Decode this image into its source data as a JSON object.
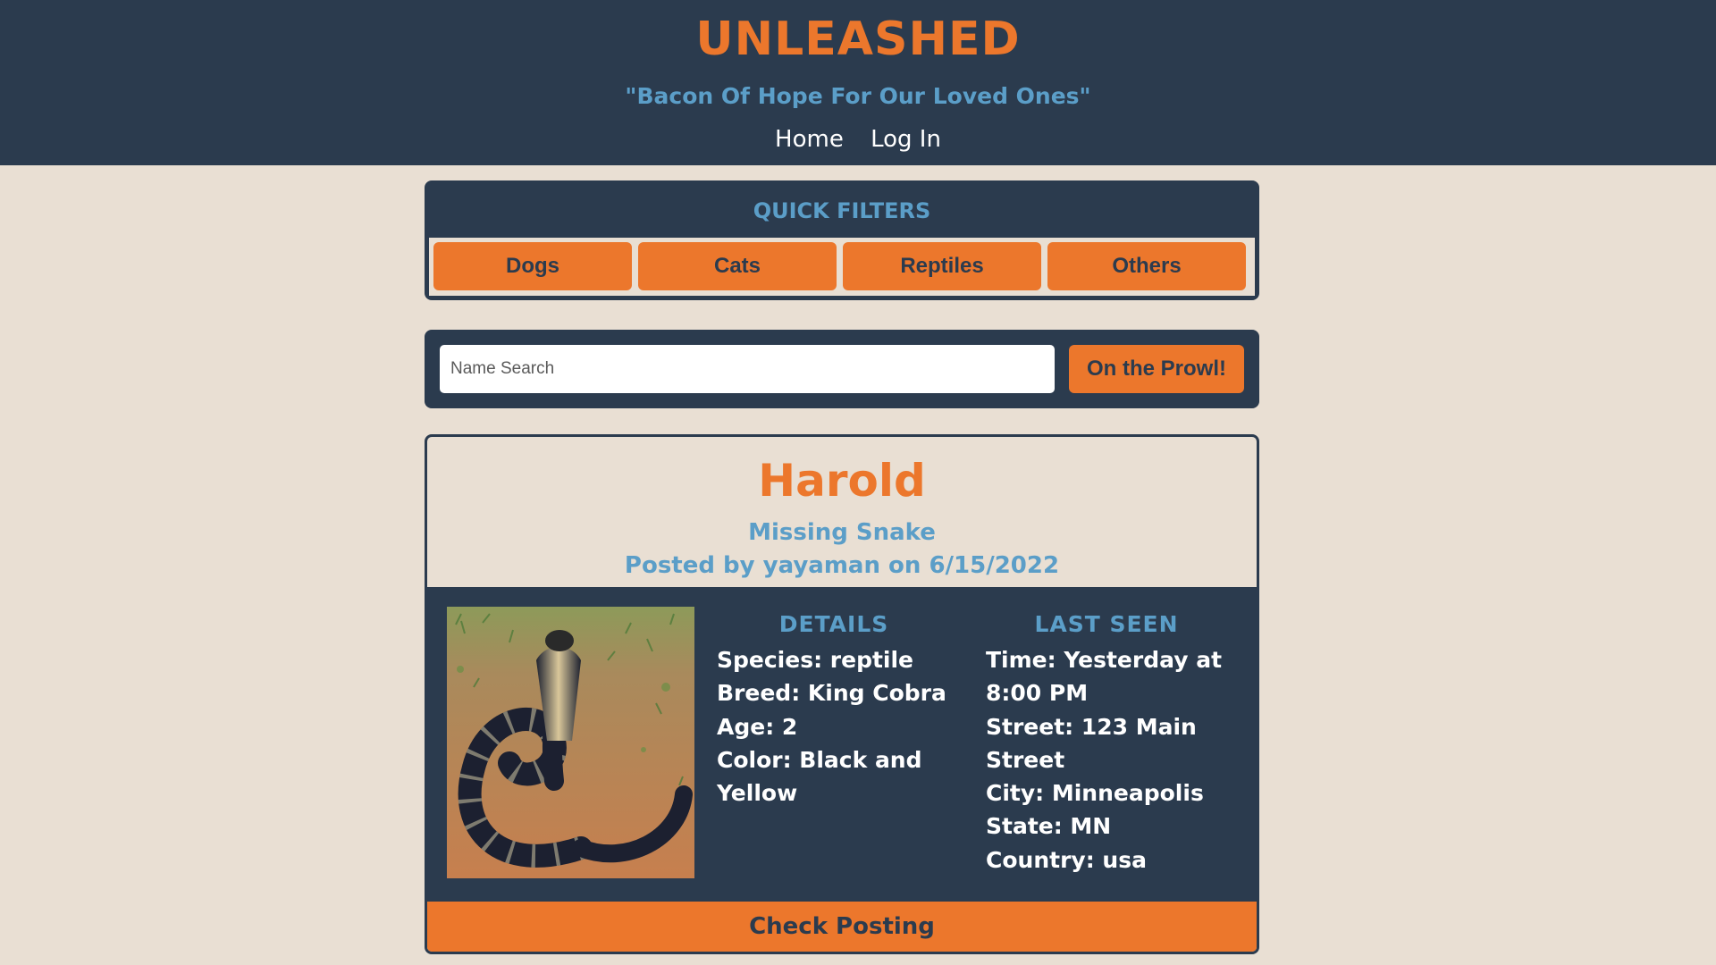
{
  "header": {
    "title": "UNLEASHED",
    "tagline": "\"Bacon Of Hope For Our Loved Ones\"",
    "nav": [
      "Home",
      "Log In"
    ]
  },
  "filters": {
    "title": "QUICK FILTERS",
    "buttons": [
      "Dogs",
      "Cats",
      "Reptiles",
      "Others"
    ]
  },
  "search": {
    "placeholder": "Name Search",
    "value": "",
    "button_label": "On the Prowl!"
  },
  "post": {
    "name": "Harold",
    "status": "Missing Snake",
    "posted": "Posted by yayaman on 6/15/2022",
    "details_heading": "DETAILS",
    "details_lines": [
      "Species: reptile",
      "Breed: King Cobra",
      "Age: 2",
      "Color: Black and",
      "Yellow"
    ],
    "last_seen_heading": "LAST SEEN",
    "last_seen_lines": [
      "Time: Yesterday at",
      "8:00 PM",
      "Street: 123 Main",
      "Street",
      "City: Minneapolis",
      "State: MN",
      "Country: usa"
    ],
    "button_label": "Check Posting"
  },
  "colors": {
    "navy": "#2b3b4e",
    "orange": "#ec772c",
    "blue": "#5b9ec8",
    "cream": "#e9dfd3"
  }
}
